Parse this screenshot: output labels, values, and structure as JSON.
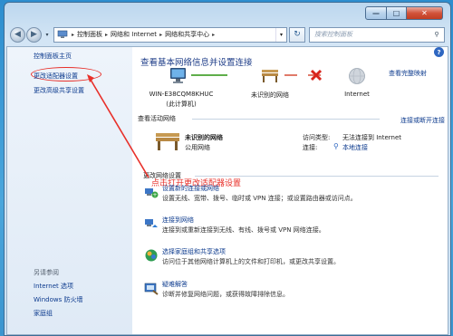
{
  "window": {
    "buttons": {
      "minimize": "—",
      "maximize": "□",
      "close": "✕"
    }
  },
  "nav": {
    "back": "◀",
    "forward": "▶",
    "recent": "▾",
    "breadcrumbs": [
      "控制面板",
      "网络和 Internet",
      "网络和共享中心"
    ],
    "refresh": "↻",
    "search_placeholder": "搜索控制面板"
  },
  "sidebar": {
    "home": "控制面板主页",
    "items": [
      {
        "label": "更改适配器设置"
      },
      {
        "label": "更改高级共享设置"
      }
    ],
    "see_also": "另请参阅",
    "see_also_items": [
      {
        "label": "Internet 选项"
      },
      {
        "label": "Windows 防火墙"
      },
      {
        "label": "家庭组"
      }
    ]
  },
  "main": {
    "help": "?",
    "title": "查看基本网络信息并设置连接",
    "view_full_map": "查看完整映射",
    "map": {
      "computer_name": "WIN-E38CQM8KHUC",
      "computer_sub": "(此计算机)",
      "network_label": "未识别的网络",
      "internet_label": "Internet"
    },
    "active_header": "查看活动网络",
    "connect_disconnect": "连接或断开连接",
    "active_network": {
      "name": "未识别的网络",
      "type": "公用网络",
      "access_label": "访问类型:",
      "access_value": "无法连接到 Internet",
      "connection_label": "连接:",
      "connection_value": "本地连接"
    },
    "change_header": "更改网络设置",
    "annotation": "点击打开更改适配器设置",
    "tasks": [
      {
        "icon": "network-setup-icon",
        "link": "设置新的连接或网络",
        "desc": "设置无线、宽带、拨号、临时或 VPN 连接；或设置路由器或访问点。"
      },
      {
        "icon": "connect-network-icon",
        "link": "连接到网络",
        "desc": "连接到或重新连接到无线、有线、拨号或 VPN 网络连接。"
      },
      {
        "icon": "homegroup-icon",
        "link": "选择家庭组和共享选项",
        "desc": "访问位于其他网络计算机上的文件和打印机，或更改共享设置。"
      },
      {
        "icon": "troubleshoot-icon",
        "link": "疑难解答",
        "desc": "诊断并修复网络问题，或获得故障排除信息。"
      }
    ]
  },
  "colors": {
    "link": "#0d3b8e",
    "annotation": "#e8302a",
    "title": "#1e3d88"
  }
}
